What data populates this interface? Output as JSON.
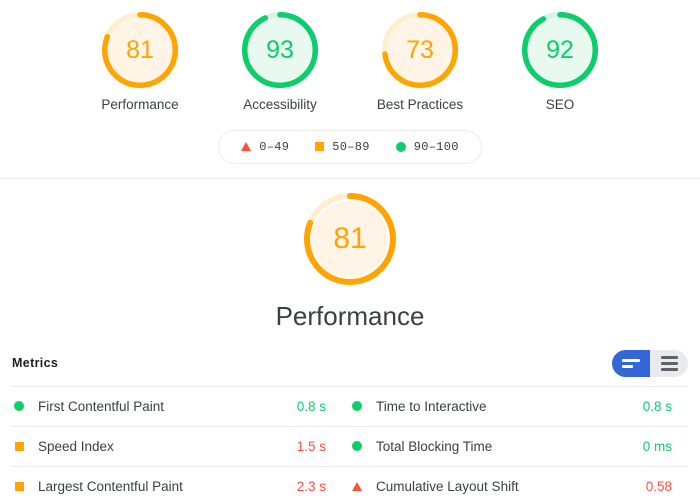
{
  "colors": {
    "pass": "#0cce6b",
    "average": "#ffa400",
    "fail": "#ff4e42",
    "pass_bg": "#e8f9ef",
    "average_bg": "#fff4e5",
    "fail_bg": "#fff0ee",
    "blue_active": "#3367d6",
    "text": "#3c4043",
    "divider": "#ebebeb"
  },
  "scores": {
    "items": [
      {
        "value": 81,
        "label": "Performance",
        "rating": "average",
        "icon": "gauge-arc"
      },
      {
        "value": 93,
        "label": "Accessibility",
        "rating": "pass",
        "icon": "gauge-arc"
      },
      {
        "value": 73,
        "label": "Best Practices",
        "rating": "average",
        "icon": "gauge-arc"
      },
      {
        "value": 92,
        "label": "SEO",
        "rating": "pass",
        "icon": "gauge-arc"
      }
    ]
  },
  "legend": {
    "items": [
      {
        "range": "0–49",
        "marker": "triangle-marker",
        "rating": "fail"
      },
      {
        "range": "50–89",
        "marker": "square-marker",
        "rating": "average"
      },
      {
        "range": "90–100",
        "marker": "circle-marker",
        "rating": "pass"
      }
    ]
  },
  "category": {
    "score": 81,
    "title": "Performance",
    "rating": "average"
  },
  "metrics": {
    "heading": "Metrics",
    "toggle": {
      "active_option": "filmstrip-view",
      "options": [
        {
          "name": "filmstrip-view",
          "icon": "filmstrip-icon",
          "active": true
        },
        {
          "name": "list-view",
          "icon": "list-icon",
          "active": false
        }
      ]
    },
    "left_column": [
      {
        "name": "First Contentful Paint",
        "value": "0.8 s",
        "rating": "pass",
        "marker": "circle-marker",
        "value_color": "#0cce6b"
      },
      {
        "name": "Speed Index",
        "value": "1.5 s",
        "rating": "average",
        "marker": "square-marker",
        "value_color": "#ff4e42"
      },
      {
        "name": "Largest Contentful Paint",
        "value": "2.3 s",
        "rating": "average",
        "marker": "square-marker",
        "value_color": "#ff4e42"
      }
    ],
    "right_column": [
      {
        "name": "Time to Interactive",
        "value": "0.8 s",
        "rating": "pass",
        "marker": "circle-marker",
        "value_color": "#0cce6b"
      },
      {
        "name": "Total Blocking Time",
        "value": "0 ms",
        "rating": "pass",
        "marker": "circle-marker",
        "value_color": "#0cce6b"
      },
      {
        "name": "Cumulative Layout Shift",
        "value": "0.58",
        "rating": "fail",
        "marker": "triangle-marker",
        "value_color": "#ff4e42"
      }
    ]
  }
}
